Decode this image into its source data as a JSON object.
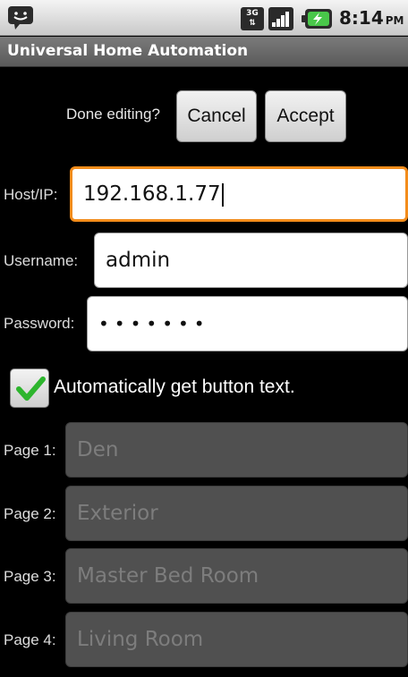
{
  "status_bar": {
    "notification_icon": "chat-bubble-icon",
    "network_icon": "3g-data-icon",
    "network_label": "3G",
    "signal_icon": "signal-bars-icon",
    "battery_icon": "battery-charging-icon",
    "time": "8:14",
    "ampm": "PM"
  },
  "title_bar": {
    "title": "Universal Home Automation"
  },
  "editing": {
    "prompt": "Done editing?",
    "cancel_label": "Cancel",
    "accept_label": "Accept"
  },
  "fields": {
    "host": {
      "label": "Host/IP:",
      "value": "192.168.1.77"
    },
    "username": {
      "label": "Username:",
      "value": "admin"
    },
    "password": {
      "label": "Password:",
      "value": "•••••••"
    }
  },
  "auto_text": {
    "label": "Automatically get button text.",
    "checked": true
  },
  "pages": [
    {
      "label": "Page 1:",
      "value": "Den"
    },
    {
      "label": "Page 2:",
      "value": "Exterior"
    },
    {
      "label": "Page 3:",
      "value": "Master Bed Room"
    },
    {
      "label": "Page 4:",
      "value": "Living Room"
    }
  ],
  "colors": {
    "focus_border": "#f38c1b",
    "check_green": "#2db52d"
  }
}
